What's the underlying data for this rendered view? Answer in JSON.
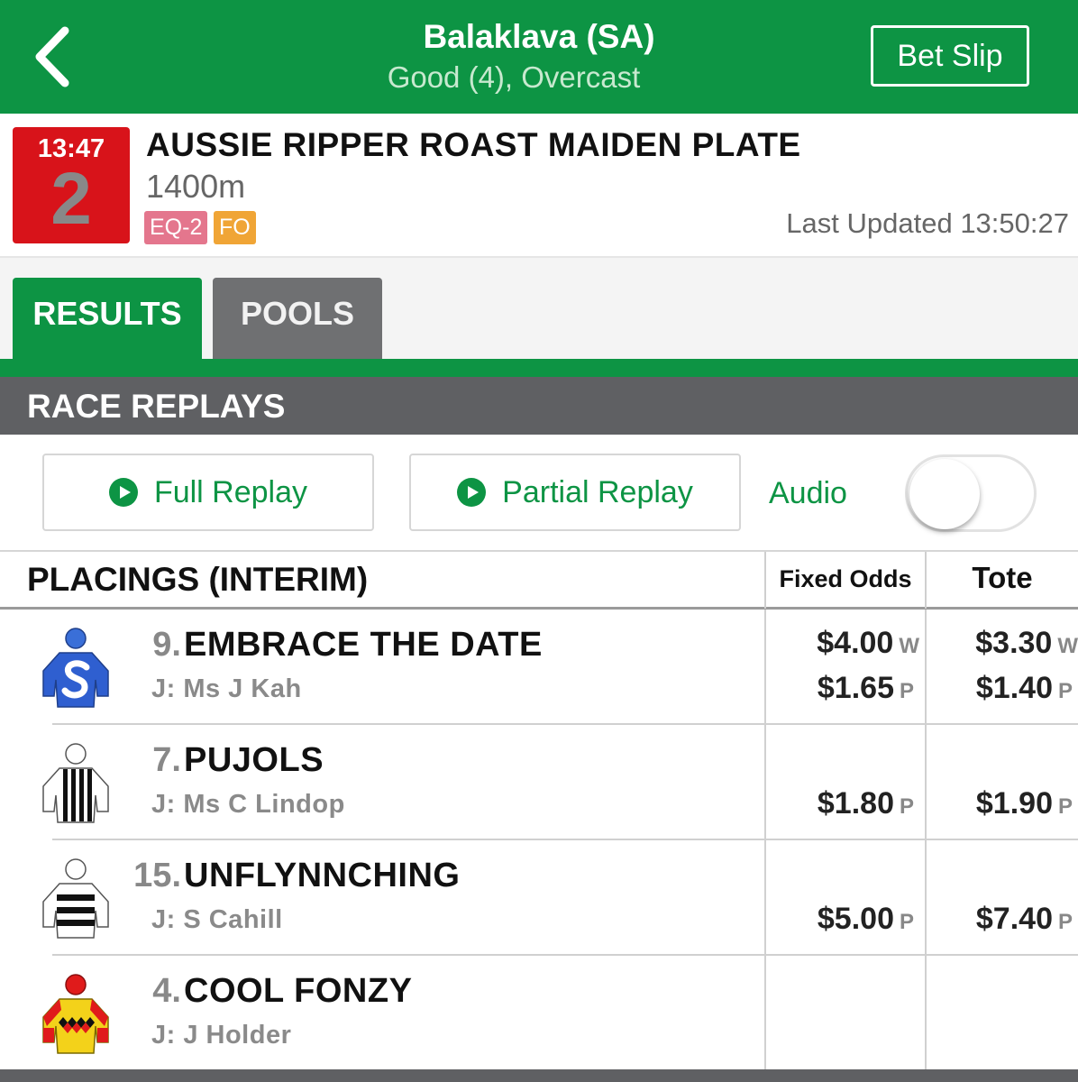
{
  "header": {
    "venue": "Balaklava (SA)",
    "conditions": "Good (4), Overcast",
    "bet_slip": "Bet Slip"
  },
  "race": {
    "time": "13:47",
    "number": "2",
    "title": "AUSSIE RIPPER ROAST MAIDEN PLATE",
    "distance": "1400m",
    "tags": [
      "EQ-2",
      "FO"
    ],
    "last_updated": "Last Updated 13:50:27"
  },
  "tabs": [
    "RESULTS",
    "POOLS"
  ],
  "replays": {
    "title": "RACE REPLAYS",
    "full": "Full Replay",
    "partial": "Partial Replay",
    "audio_label": "Audio",
    "audio_on": false
  },
  "placings": {
    "title": "PLACINGS (INTERIM)",
    "col_fixed": "Fixed Odds",
    "col_tote": "Tote",
    "rows": [
      {
        "num": "9.",
        "name": "EMBRACE THE DATE",
        "jockey": "J: Ms J Kah",
        "fixed_w": "$4.00",
        "fixed_p": "$1.65",
        "tote_w": "$3.30",
        "tote_p": "$1.40"
      },
      {
        "num": "7.",
        "name": "PUJOLS",
        "jockey": "J: Ms C Lindop",
        "fixed_p": "$1.80",
        "tote_p": "$1.90"
      },
      {
        "num": "15.",
        "name": "UNFLYNNCHING",
        "jockey": "J: S Cahill",
        "fixed_p": "$5.00",
        "tote_p": "$7.40"
      },
      {
        "num": "4.",
        "name": "COOL FONZY",
        "jockey": "J: J Holder"
      }
    ],
    "w_suffix": "W",
    "p_suffix": "P"
  },
  "colors": {
    "brand_green": "#0d9444",
    "race_red": "#d8131a",
    "section_grey": "#5f6063"
  },
  "icons": [
    "back-chevron-icon",
    "play-icon",
    "jockey-silk-icon"
  ]
}
